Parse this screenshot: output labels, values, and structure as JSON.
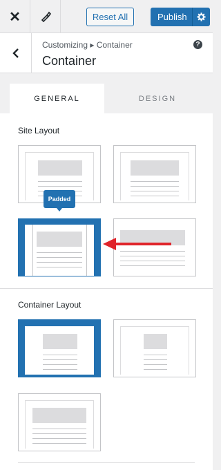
{
  "topbar": {
    "close_glyph": "✕",
    "reset_label": "Reset All",
    "publish_label": "Publish",
    "icons": [
      "close-icon",
      "brush-icon",
      "gear-icon"
    ]
  },
  "section": {
    "breadcrumb": "Customizing ▸ Container",
    "title": "Container",
    "help_glyph": "?",
    "back_glyph": "‹"
  },
  "tabs": [
    {
      "label": "GENERAL",
      "active": true
    },
    {
      "label": "DESIGN",
      "active": false
    }
  ],
  "site_layout": {
    "label": "Site Layout",
    "tooltip": "Padded",
    "options_count": 4,
    "selected_option": "padded"
  },
  "container_layout": {
    "label": "Container Layout",
    "options_count": 3,
    "selected_option": 1
  },
  "colors": {
    "accent": "#2271b1",
    "arrow": "#e0242b",
    "placeholder": "#dcdcde"
  }
}
